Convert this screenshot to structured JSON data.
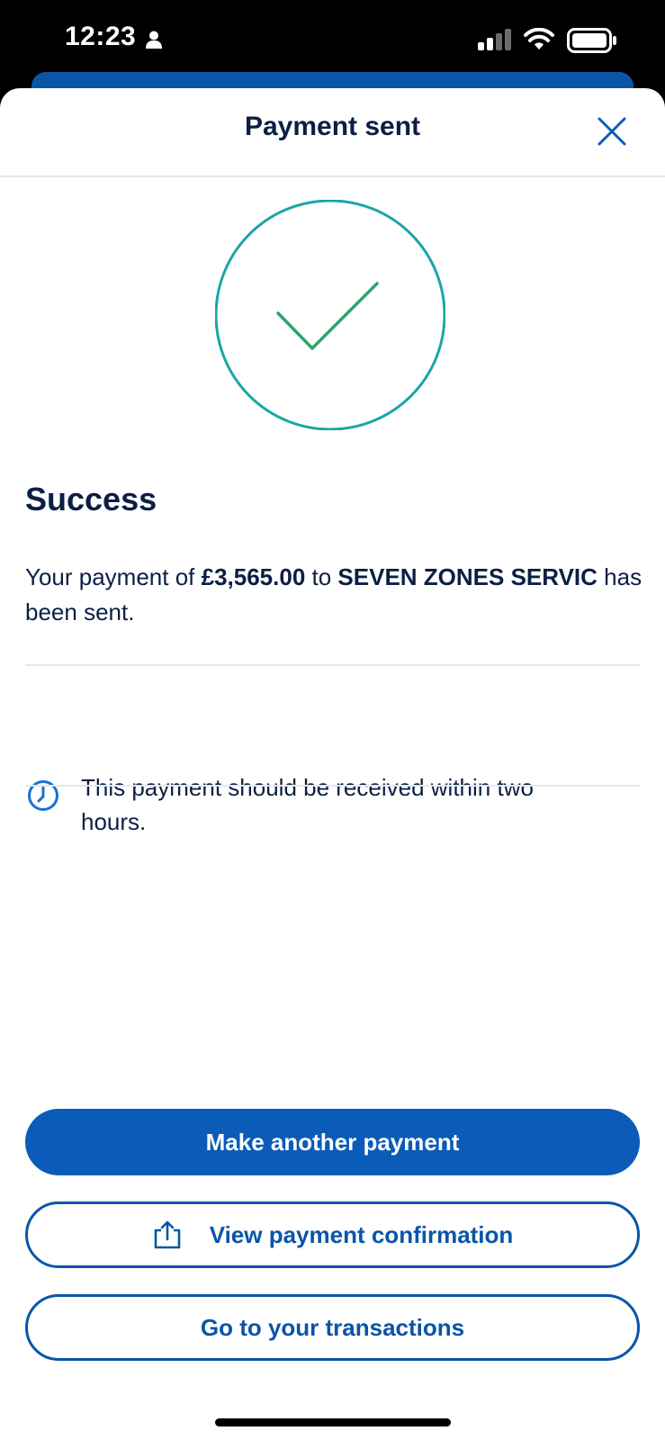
{
  "status_bar": {
    "time": "12:23",
    "icons": [
      "person-icon",
      "cellular-signal-icon",
      "wifi-icon",
      "battery-icon"
    ]
  },
  "header": {
    "title": "Payment sent",
    "close_icon": "close-icon"
  },
  "success": {
    "icon": "check-circle-icon",
    "heading": "Success",
    "message_prefix": "Your payment of ",
    "amount": "£3,565.00",
    "message_middle": " to ",
    "payee": "SEVEN ZONES SERVIC",
    "message_suffix": " has been sent."
  },
  "info": {
    "icon": "clock-icon",
    "text": "This payment should be received within two hours."
  },
  "actions": {
    "make_another_label": "Make another payment",
    "view_confirmation_label": "View payment confirmation",
    "view_confirmation_icon": "share-icon",
    "transactions_label": "Go to your transactions"
  },
  "colors": {
    "primary": "#0a5cb8",
    "text": "#0b1f44",
    "success_ring": "#1aa5a5",
    "success_check": "#2aa56a",
    "divider": "#e5e7eb"
  }
}
